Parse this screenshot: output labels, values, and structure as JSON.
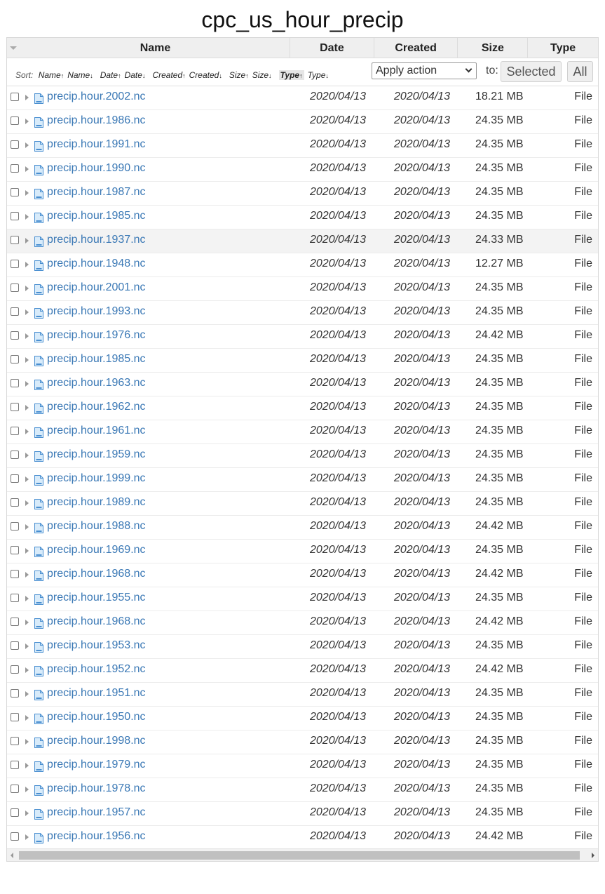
{
  "title": "cpc_us_hour_precip",
  "columns": {
    "name": "Name",
    "date": "Date",
    "created": "Created",
    "size": "Size",
    "type": "Type"
  },
  "sort": {
    "label": "Sort:",
    "links": [
      {
        "label": "Name",
        "dir": "↑",
        "active": false
      },
      {
        "label": "Name",
        "dir": "↓",
        "active": false
      },
      {
        "label": "Date",
        "dir": "↑",
        "active": false
      },
      {
        "label": "Date",
        "dir": "↓",
        "active": false
      },
      {
        "label": "Created",
        "dir": "↑",
        "active": false
      },
      {
        "label": "Created",
        "dir": "↓",
        "active": false
      },
      {
        "label": "Size",
        "dir": "↑",
        "active": false
      },
      {
        "label": "Size",
        "dir": "↓",
        "active": false
      },
      {
        "label": "Type",
        "dir": "↑",
        "active": true
      },
      {
        "label": "Type",
        "dir": "↓",
        "active": false
      }
    ]
  },
  "actions": {
    "select_value": "Apply action",
    "to_label": "to:",
    "selected_button": "Selected",
    "all_button": "All"
  },
  "icons": {
    "column_toggle": "triangle-down-icon",
    "expand": "triangle-right-icon",
    "file": "file-icon"
  },
  "colors": {
    "link": "#3a78b5",
    "header_bg": "#efefef",
    "hover_row": "#f3f3f3"
  },
  "files": [
    {
      "name": "precip.hour.2002.nc",
      "date": "2020/04/13",
      "created": "2020/04/13",
      "size": "18.21 MB",
      "type": "File"
    },
    {
      "name": "precip.hour.1986.nc",
      "date": "2020/04/13",
      "created": "2020/04/13",
      "size": "24.35 MB",
      "type": "File"
    },
    {
      "name": "precip.hour.1991.nc",
      "date": "2020/04/13",
      "created": "2020/04/13",
      "size": "24.35 MB",
      "type": "File"
    },
    {
      "name": "precip.hour.1990.nc",
      "date": "2020/04/13",
      "created": "2020/04/13",
      "size": "24.35 MB",
      "type": "File"
    },
    {
      "name": "precip.hour.1987.nc",
      "date": "2020/04/13",
      "created": "2020/04/13",
      "size": "24.35 MB",
      "type": "File"
    },
    {
      "name": "precip.hour.1985.nc",
      "date": "2020/04/13",
      "created": "2020/04/13",
      "size": "24.35 MB",
      "type": "File"
    },
    {
      "name": "precip.hour.1937.nc",
      "date": "2020/04/13",
      "created": "2020/04/13",
      "size": "24.33 MB",
      "type": "File",
      "hover": true
    },
    {
      "name": "precip.hour.1948.nc",
      "date": "2020/04/13",
      "created": "2020/04/13",
      "size": "12.27 MB",
      "type": "File"
    },
    {
      "name": "precip.hour.2001.nc",
      "date": "2020/04/13",
      "created": "2020/04/13",
      "size": "24.35 MB",
      "type": "File"
    },
    {
      "name": "precip.hour.1993.nc",
      "date": "2020/04/13",
      "created": "2020/04/13",
      "size": "24.35 MB",
      "type": "File"
    },
    {
      "name": "precip.hour.1976.nc",
      "date": "2020/04/13",
      "created": "2020/04/13",
      "size": "24.42 MB",
      "type": "File"
    },
    {
      "name": "precip.hour.1985.nc",
      "date": "2020/04/13",
      "created": "2020/04/13",
      "size": "24.35 MB",
      "type": "File"
    },
    {
      "name": "precip.hour.1963.nc",
      "date": "2020/04/13",
      "created": "2020/04/13",
      "size": "24.35 MB",
      "type": "File"
    },
    {
      "name": "precip.hour.1962.nc",
      "date": "2020/04/13",
      "created": "2020/04/13",
      "size": "24.35 MB",
      "type": "File"
    },
    {
      "name": "precip.hour.1961.nc",
      "date": "2020/04/13",
      "created": "2020/04/13",
      "size": "24.35 MB",
      "type": "File"
    },
    {
      "name": "precip.hour.1959.nc",
      "date": "2020/04/13",
      "created": "2020/04/13",
      "size": "24.35 MB",
      "type": "File"
    },
    {
      "name": "precip.hour.1999.nc",
      "date": "2020/04/13",
      "created": "2020/04/13",
      "size": "24.35 MB",
      "type": "File"
    },
    {
      "name": "precip.hour.1989.nc",
      "date": "2020/04/13",
      "created": "2020/04/13",
      "size": "24.35 MB",
      "type": "File"
    },
    {
      "name": "precip.hour.1988.nc",
      "date": "2020/04/13",
      "created": "2020/04/13",
      "size": "24.42 MB",
      "type": "File"
    },
    {
      "name": "precip.hour.1969.nc",
      "date": "2020/04/13",
      "created": "2020/04/13",
      "size": "24.35 MB",
      "type": "File"
    },
    {
      "name": "precip.hour.1968.nc",
      "date": "2020/04/13",
      "created": "2020/04/13",
      "size": "24.42 MB",
      "type": "File"
    },
    {
      "name": "precip.hour.1955.nc",
      "date": "2020/04/13",
      "created": "2020/04/13",
      "size": "24.35 MB",
      "type": "File"
    },
    {
      "name": "precip.hour.1968.nc",
      "date": "2020/04/13",
      "created": "2020/04/13",
      "size": "24.42 MB",
      "type": "File"
    },
    {
      "name": "precip.hour.1953.nc",
      "date": "2020/04/13",
      "created": "2020/04/13",
      "size": "24.35 MB",
      "type": "File"
    },
    {
      "name": "precip.hour.1952.nc",
      "date": "2020/04/13",
      "created": "2020/04/13",
      "size": "24.42 MB",
      "type": "File"
    },
    {
      "name": "precip.hour.1951.nc",
      "date": "2020/04/13",
      "created": "2020/04/13",
      "size": "24.35 MB",
      "type": "File"
    },
    {
      "name": "precip.hour.1950.nc",
      "date": "2020/04/13",
      "created": "2020/04/13",
      "size": "24.35 MB",
      "type": "File"
    },
    {
      "name": "precip.hour.1998.nc",
      "date": "2020/04/13",
      "created": "2020/04/13",
      "size": "24.35 MB",
      "type": "File"
    },
    {
      "name": "precip.hour.1979.nc",
      "date": "2020/04/13",
      "created": "2020/04/13",
      "size": "24.35 MB",
      "type": "File"
    },
    {
      "name": "precip.hour.1978.nc",
      "date": "2020/04/13",
      "created": "2020/04/13",
      "size": "24.35 MB",
      "type": "File"
    },
    {
      "name": "precip.hour.1957.nc",
      "date": "2020/04/13",
      "created": "2020/04/13",
      "size": "24.35 MB",
      "type": "File"
    },
    {
      "name": "precip.hour.1956.nc",
      "date": "2020/04/13",
      "created": "2020/04/13",
      "size": "24.42 MB",
      "type": "File"
    }
  ]
}
